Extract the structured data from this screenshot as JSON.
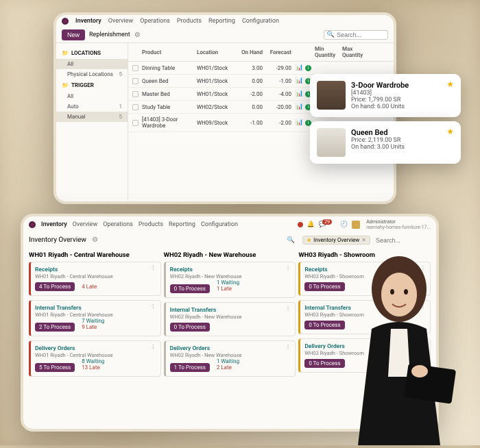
{
  "menu": {
    "app": "Inventory",
    "items": [
      "Overview",
      "Operations",
      "Products",
      "Reporting",
      "Configuration"
    ]
  },
  "win1": {
    "new_btn": "New",
    "breadcrumb": "Replenishment",
    "search_placeholder": "Search...",
    "sidebar": {
      "locations_head": "LOCATIONS",
      "trigger_head": "TRIGGER",
      "loc_items": [
        {
          "label": "All",
          "count": ""
        },
        {
          "label": "Physical Locations",
          "count": "5"
        }
      ],
      "trig_items": [
        {
          "label": "All",
          "count": ""
        },
        {
          "label": "Auto",
          "count": "1"
        },
        {
          "label": "Manual",
          "count": "5"
        }
      ]
    },
    "table": {
      "columns": [
        "Product",
        "Location",
        "On Hand",
        "Forecast",
        "",
        "",
        "Min Quantity",
        "Max Quantity"
      ],
      "rows": [
        {
          "product": "Dinning Table",
          "location": "WH01/Stock",
          "onhand": "3.00",
          "forecast": "-29.00"
        },
        {
          "product": "Queen Bed",
          "location": "WH01/Stock",
          "onhand": "0.00",
          "forecast": "-1.00"
        },
        {
          "product": "Master Bed",
          "location": "WH01/Stock",
          "onhand": "-2.00",
          "forecast": "-4.00"
        },
        {
          "product": "Study Table",
          "location": "WH02/Stock",
          "onhand": "0.00",
          "forecast": "-20.00"
        },
        {
          "product": "[41403] 3-Door Wardrobe",
          "location": "WH09/Stock",
          "onhand": "-1.00",
          "forecast": "-2.00"
        }
      ]
    }
  },
  "cards": [
    {
      "title": "3-Door Wardrobe",
      "sku": "[41403]",
      "price": "Price: 1,799.00 SR",
      "onhand": "On hand: 6.00 Units"
    },
    {
      "title": "Queen Bed",
      "sku": "",
      "price": "Price: 2,119.00 SR",
      "onhand": "On hand: 3.00 Units"
    }
  ],
  "win2": {
    "title": "Inventory Overview",
    "chip_label": "Inventory Overview",
    "search_placeholder": "Search...",
    "admin_label": "Administrator",
    "admin_db": "reemahy-homes-furniture-17...",
    "msg_badge": "29",
    "columns": [
      {
        "title": "WH01 Riyadh - Central Warehouse",
        "accent": "accent-red",
        "cards": [
          {
            "title": "Receipts",
            "sub": "WH01 Riyadh - Central Warehouse",
            "pill": "4 To Process",
            "stat1": "4 Late",
            "cls1": "late"
          },
          {
            "title": "Internal Transfers",
            "sub": "WH01 Riyadh - Central Warehouse",
            "pill": "2 To Process",
            "stat1": "7 Waiting",
            "cls1": "wait",
            "stat2": "9 Late",
            "cls2": "late"
          },
          {
            "title": "Delivery Orders",
            "sub": "WH01 Riyadh - Central Warehouse",
            "pill": "5 To Process",
            "stat1": "8 Waiting",
            "cls1": "wait",
            "stat2": "13 Late",
            "cls2": "late"
          }
        ]
      },
      {
        "title": "WH02 Riyadh - New Warehouse",
        "accent": "accent-grey",
        "cards": [
          {
            "title": "Receipts",
            "sub": "WH02 Riyadh - New Warehouse",
            "pill": "0 To Process",
            "stat1": "1 Waiting",
            "cls1": "wait",
            "stat2": "1 Late",
            "cls2": "late"
          },
          {
            "title": "Internal Transfers",
            "sub": "WH02 Riyadh - New Warehouse",
            "pill": "0 To Process"
          },
          {
            "title": "Delivery Orders",
            "sub": "WH02 Riyadh - New Warehouse",
            "pill": "1 To Process",
            "stat1": "1 Waiting",
            "cls1": "wait",
            "stat2": "2 Late",
            "cls2": "late"
          }
        ]
      },
      {
        "title": "WH03 Riyadh - Showroom",
        "accent": "accent-yellow",
        "cards": [
          {
            "title": "Receipts",
            "sub": "WH03 Riyadh - Showroom",
            "pill": "0 To Process"
          },
          {
            "title": "Internal Transfers",
            "sub": "WH03 Riyadh - Showroom",
            "pill": "0 To Process"
          },
          {
            "title": "Delivery Orders",
            "sub": "WH03 Riyadh - Showroom",
            "pill": "0 To Process"
          }
        ]
      }
    ]
  }
}
